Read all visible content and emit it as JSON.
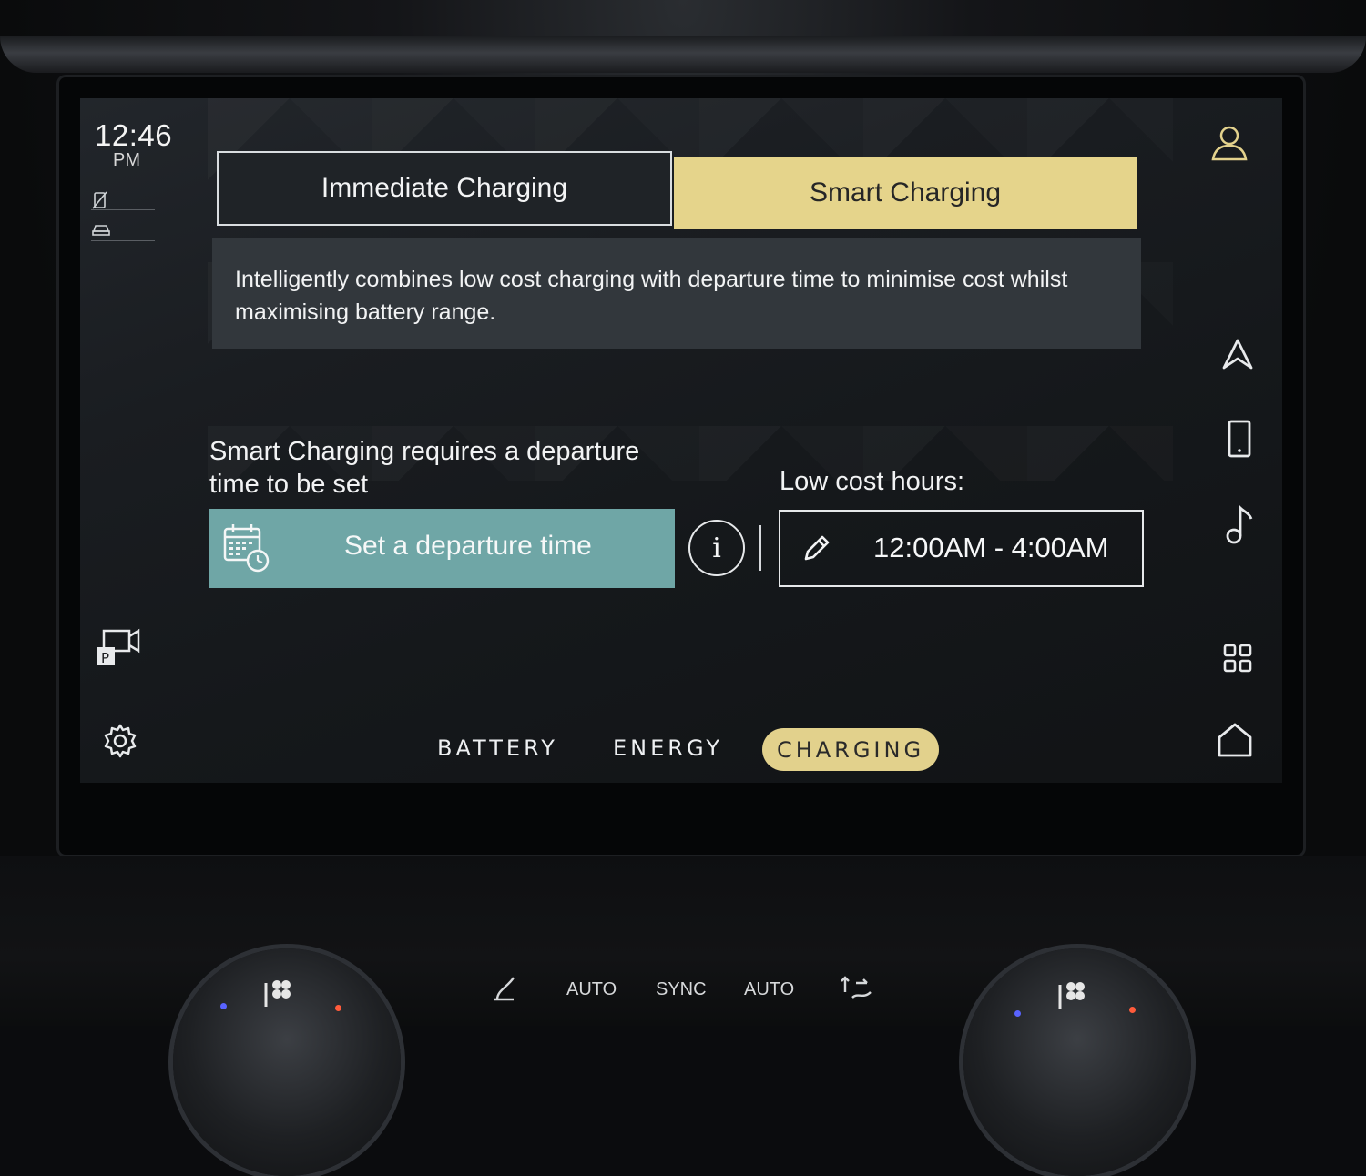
{
  "status": {
    "time": "12:46",
    "ampm": "PM"
  },
  "charging_tabs": {
    "immediate_label": "Immediate Charging",
    "smart_label": "Smart Charging",
    "selected": "Smart Charging"
  },
  "description": "Intelligently combines low cost charging with departure time to minimise cost whilst maximising battery range.",
  "departure": {
    "requirement_text": "Smart Charging requires a departure time to be set",
    "button_label": "Set a departure time",
    "info_label": "i"
  },
  "low_cost": {
    "label": "Low cost hours:",
    "hours": "12:00AM - 4:00AM"
  },
  "bottom_nav": {
    "battery": "BATTERY",
    "energy": "ENERGY",
    "charging": "CHARGING",
    "selected": "CHARGING"
  },
  "climate": {
    "auto_left": "AUTO",
    "sync": "SYNC",
    "auto_right": "AUTO"
  },
  "icons": {
    "profile": "user-icon",
    "navigation": "navigation-arrow-icon",
    "phone": "phone-icon",
    "media": "music-note-icon",
    "apps": "grid-icon",
    "home": "home-icon",
    "parking_camera": "parking-camera-icon",
    "settings": "gear-icon"
  },
  "colors": {
    "accent_gold": "#e5d48b",
    "departure_teal": "#6fa6a6",
    "panel": "#32373c"
  }
}
